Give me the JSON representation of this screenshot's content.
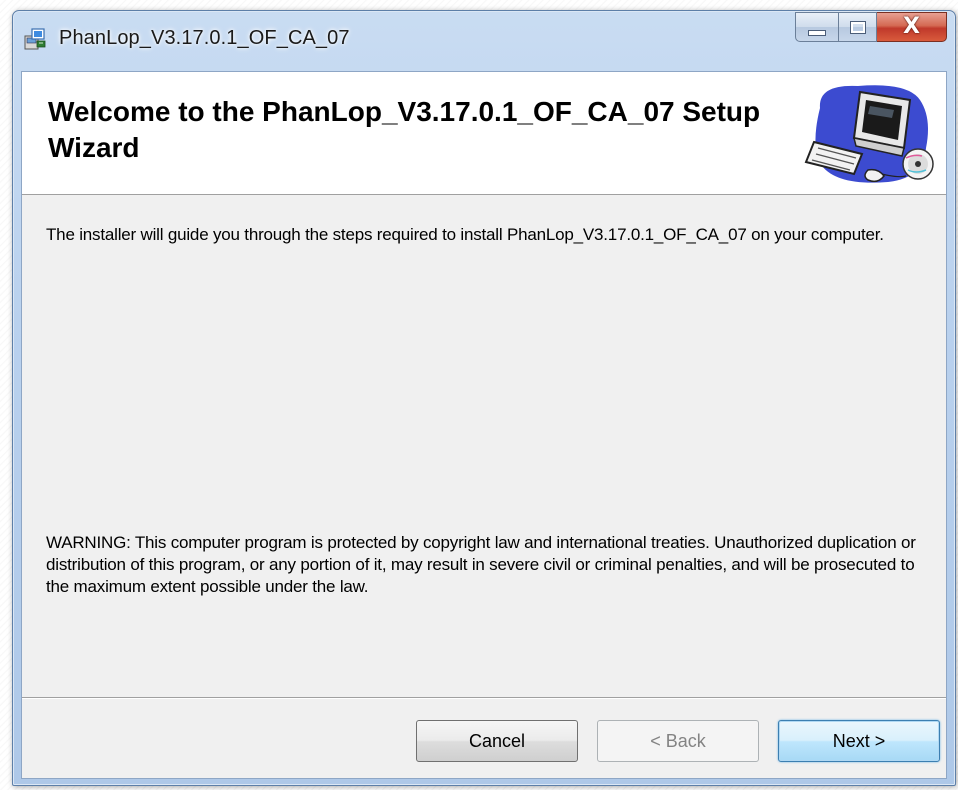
{
  "window": {
    "title": "PhanLop_V3.17.0.1_OF_CA_07",
    "icon": "installer-package-icon",
    "caption_buttons": {
      "minimize_icon": "minimize-icon",
      "maximize_icon": "maximize-icon",
      "close_label": "X"
    }
  },
  "banner": {
    "title": "Welcome to the PhanLop_V3.17.0.1_OF_CA_07 Setup Wizard",
    "image": "computer-setup-icon"
  },
  "content": {
    "intro": "The installer will guide you through the steps required to install PhanLop_V3.17.0.1_OF_CA_07 on your computer.",
    "warning": "WARNING: This computer program is protected by copyright law and international treaties. Unauthorized duplication or distribution of this program, or any portion of it, may result in severe civil or criminal penalties, and will be prosecuted to the maximum extent possible under the law."
  },
  "buttons": {
    "cancel": "Cancel",
    "back": "< Back",
    "next": "Next >"
  },
  "colors": {
    "client_bg": "#f0f0f0",
    "banner_bg": "#ffffff",
    "close_button": "#c0392b",
    "default_button_border": "#3c7fb1",
    "disabled_text": "#838383"
  }
}
